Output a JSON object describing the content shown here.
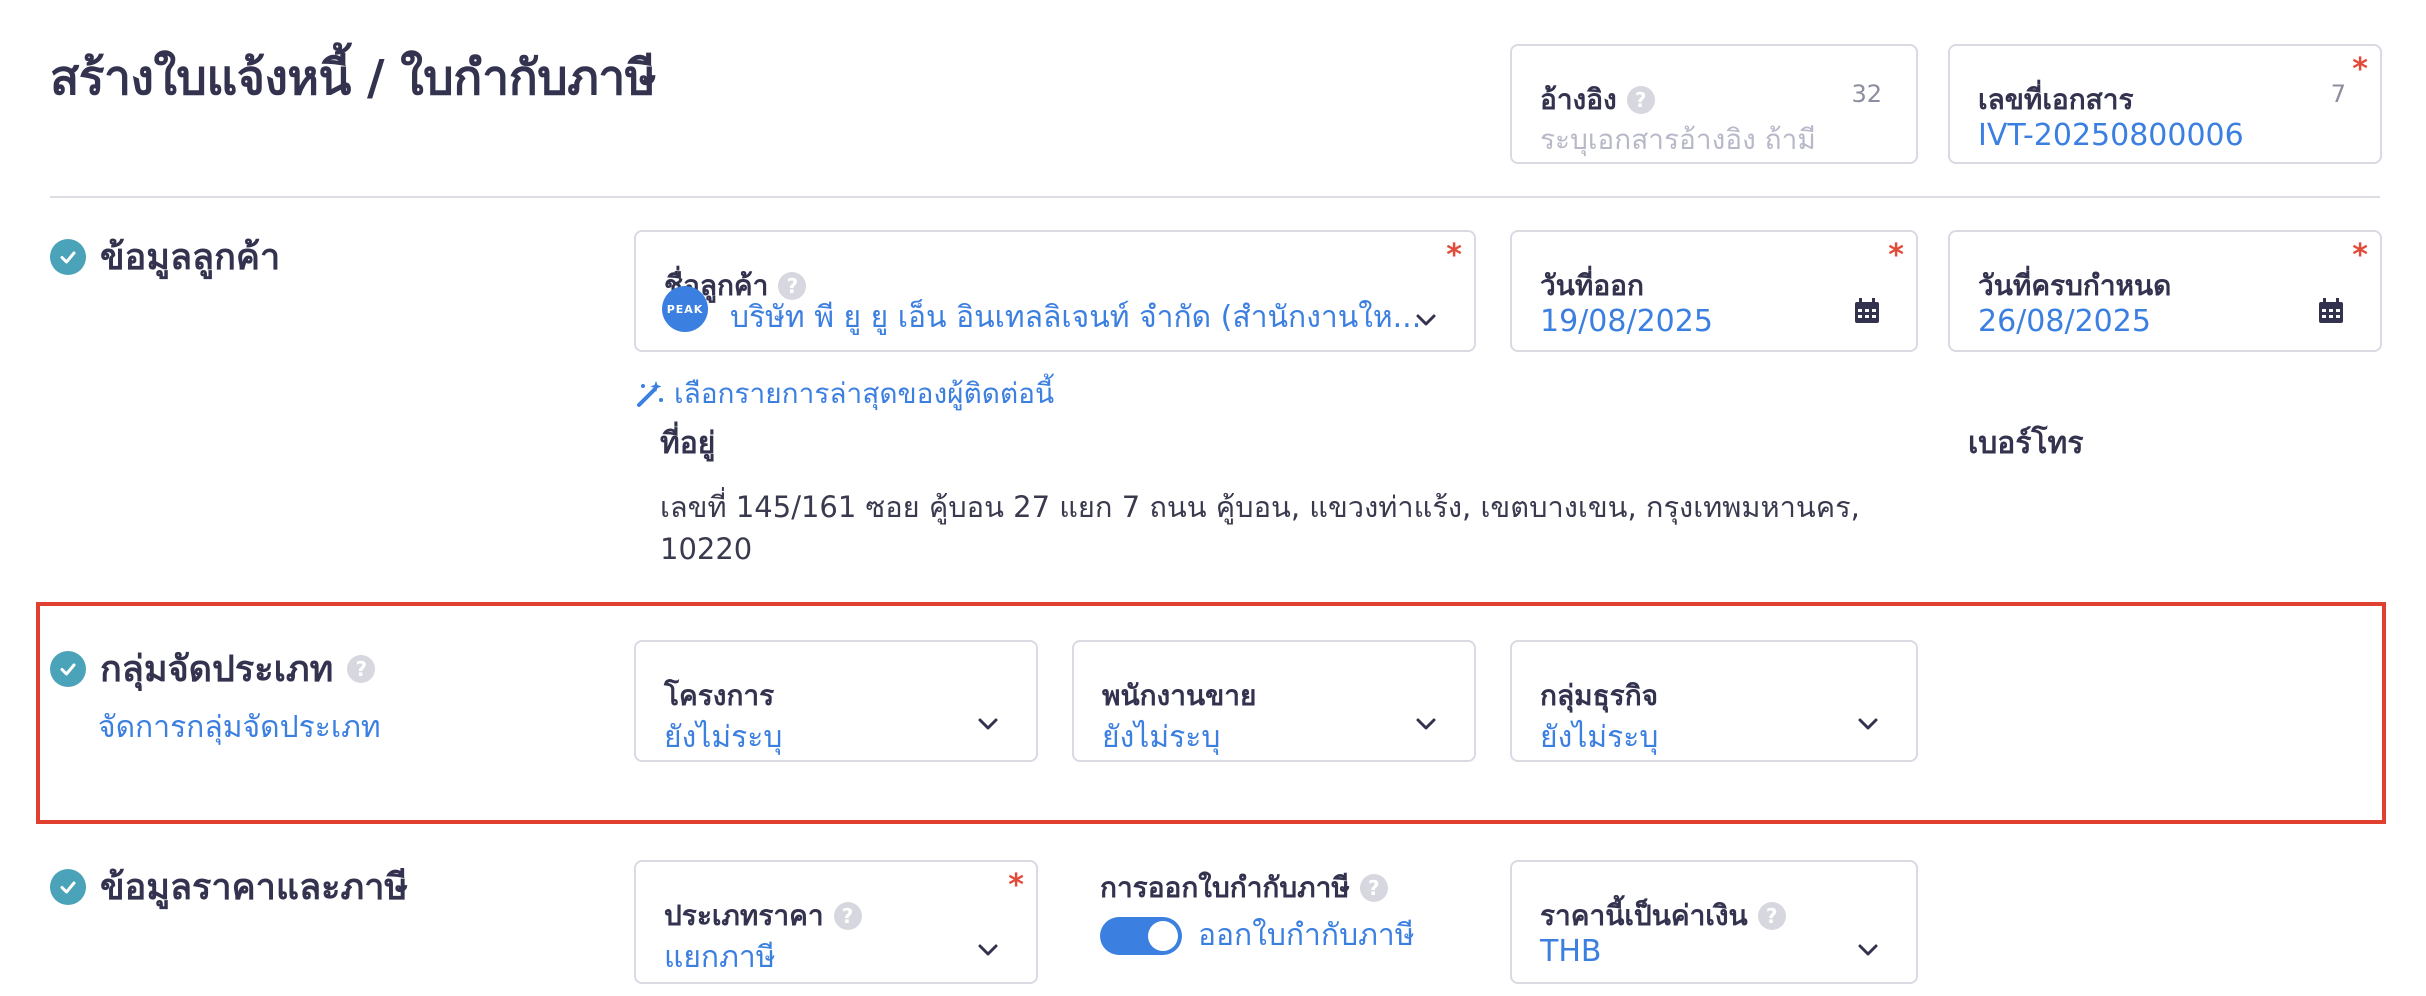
{
  "header": {
    "title": "สร้างใบแจ้งหนี้ / ใบกำกับภาษี",
    "reference": {
      "label": "อ้างอิง",
      "placeholder": "ระบุเอกสารอ้างอิง ถ้ามี",
      "counter": "32"
    },
    "doc_number": {
      "label": "เลขที่เอกสาร",
      "value": "IVT-20250800006",
      "counter": "7"
    }
  },
  "customer_section": {
    "title": "ข้อมูลลูกค้า",
    "customer_name": {
      "label": "ชื่อลูกค้า",
      "avatar_text": "PEAK",
      "value": "บริษัท พี ยู ยู เอ็น อินเทลลิเจนท์ จำกัด (สำนักงานให..."
    },
    "issue_date": {
      "label": "วันที่ออก",
      "value": "19/08/2025"
    },
    "due_date": {
      "label": "วันที่ครบกำหนด",
      "value": "26/08/2025"
    },
    "select_recent_link": "เลือกรายการล่าสุดของผู้ติดต่อนี้",
    "address_label": "ที่อยู่",
    "address_line1": "เลขที่ 145/161 ซอย คู้บอน 27 แยก 7 ถนน คู้บอน, แขวงท่าแร้ง, เขตบางเขน, กรุงเทพมหานคร,",
    "address_line2": "10220",
    "phone_label": "เบอร์โทร"
  },
  "category_section": {
    "title": "กลุ่มจัดประเภท",
    "manage_link": "จัดการกลุ่มจัดประเภท",
    "project": {
      "label": "โครงการ",
      "value": "ยังไม่ระบุ"
    },
    "salesperson": {
      "label": "พนักงานขาย",
      "value": "ยังไม่ระบุ"
    },
    "business_group": {
      "label": "กลุ่มธุรกิจ",
      "value": "ยังไม่ระบุ"
    }
  },
  "price_section": {
    "title": "ข้อมูลราคาและภาษี",
    "price_type": {
      "label": "ประเภทราคา",
      "value": "แยกภาษี"
    },
    "tax_invoice": {
      "label": "การออกใบกำกับภาษี",
      "toggle_label": "ออกใบกำกับภาษี",
      "enabled": true
    },
    "currency": {
      "label": "ราคานี้เป็นค่าเงิน",
      "value": "THB"
    }
  },
  "colors": {
    "accent": "#3b7fe0",
    "check": "#4aa3b8",
    "highlight": "#e04030",
    "required": "#e24b3a"
  }
}
